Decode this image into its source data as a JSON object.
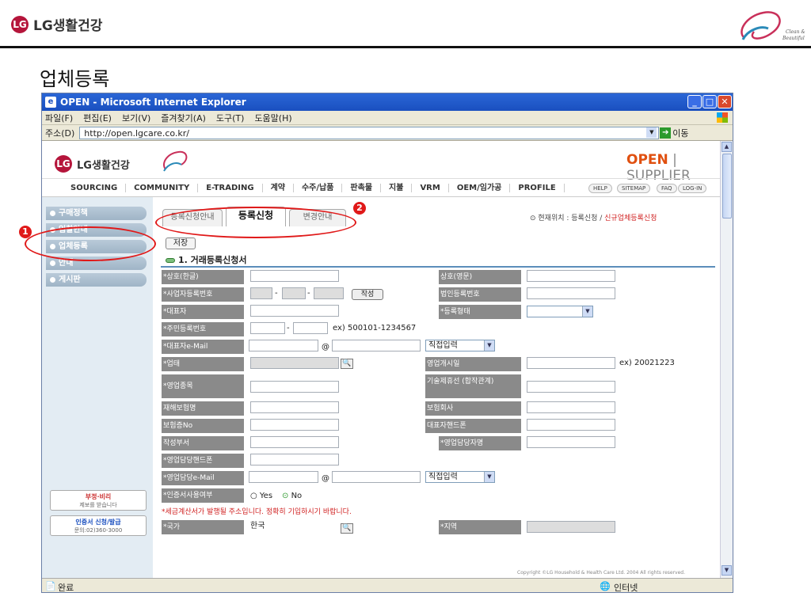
{
  "slide": {
    "logo": "LG생활건강",
    "title": "업체등록",
    "logo_mark": "LG"
  },
  "browser": {
    "title": "OPEN - Microsoft Internet Explorer",
    "menus": [
      "파일(F)",
      "편집(E)",
      "보기(V)",
      "즐겨찾기(A)",
      "도구(T)",
      "도움말(H)"
    ],
    "address_label": "주소(D)",
    "address_value": "http://open.lgcare.co.kr/",
    "go_label": "이동",
    "status": "완료",
    "zone": "인터넷"
  },
  "site": {
    "logo": "LG생활건강",
    "open": "OPEN",
    "supplier": "SUPPLIER",
    "nav": [
      "SOURCING",
      "COMMUNITY",
      "E-TRADING",
      "계약",
      "수주/납품",
      "판촉물",
      "지불",
      "VRM",
      "OEM/임가공",
      "PROFILE"
    ],
    "util": [
      "HELP",
      "SITEMAP",
      "FAQ",
      "LOG-IN"
    ],
    "sidebar": [
      "구매정책",
      "입찰안내",
      "업체등록",
      "안내",
      "게시판"
    ],
    "ads": [
      {
        "title": "부정·비리",
        "sub": "제보를 받습니다"
      },
      {
        "title": "인증서 신청/발급",
        "sub": "문의:02)360-3000"
      }
    ],
    "copyright": "Copyright ©LG Household & Health Care Ltd. 2004 All rights reserved."
  },
  "tabs": [
    "등록신청안내",
    "등록신청",
    "변경안내"
  ],
  "location": {
    "prefix": "현재위치 : 등록신청 / ",
    "current": "신규업체등록신청"
  },
  "save_label": "저장",
  "section_title": "1. 거래등록신청서",
  "form": {
    "company_kr": "*상호(한글)",
    "company_en": "상호(영문)",
    "biz_no": "*사업자등록번호",
    "biz_no_btn": "작성",
    "corp_no": "법인등록번호",
    "ceo": "*대표자",
    "reg_type": "*등록형태",
    "resident_no": "*주민등록번호",
    "resident_example": "ex) 500101-1234567",
    "ceo_email": "*대표자e-Mail",
    "at": "@",
    "direct_input": "직접입력",
    "biz_type": "*업태",
    "open_date": "영업개시일",
    "open_date_example": "ex) 20021223",
    "biz_item": "*영업종목",
    "tech_partner": "기술제휴선 (합작관계)",
    "ins_name": "재해보험명",
    "ins_company": "보험회사",
    "ins_no": "보험증No",
    "ceo_mobile": "대표자핸드폰",
    "writer_dept": "작성부서",
    "sales_manager": "*영업담당자명",
    "sales_mobile": "*영업담당핸드폰",
    "sales_email": "*영업담당e-Mail",
    "cert_use": "*인증서사용여부",
    "cert_yes": "Yes",
    "cert_no": "No",
    "notice": "*세금계산서가 발행될 주소입니다. 정확히 기입하시기 바랍니다.",
    "country": "*국가",
    "country_value": "한국",
    "region": "*지역"
  },
  "annotations": [
    "1",
    "2"
  ],
  "colors": {
    "ie_title": "#1a4fbf",
    "annotation": "#e01919",
    "open_orange": "#e05010",
    "label_gray": "#8a8a8a"
  }
}
